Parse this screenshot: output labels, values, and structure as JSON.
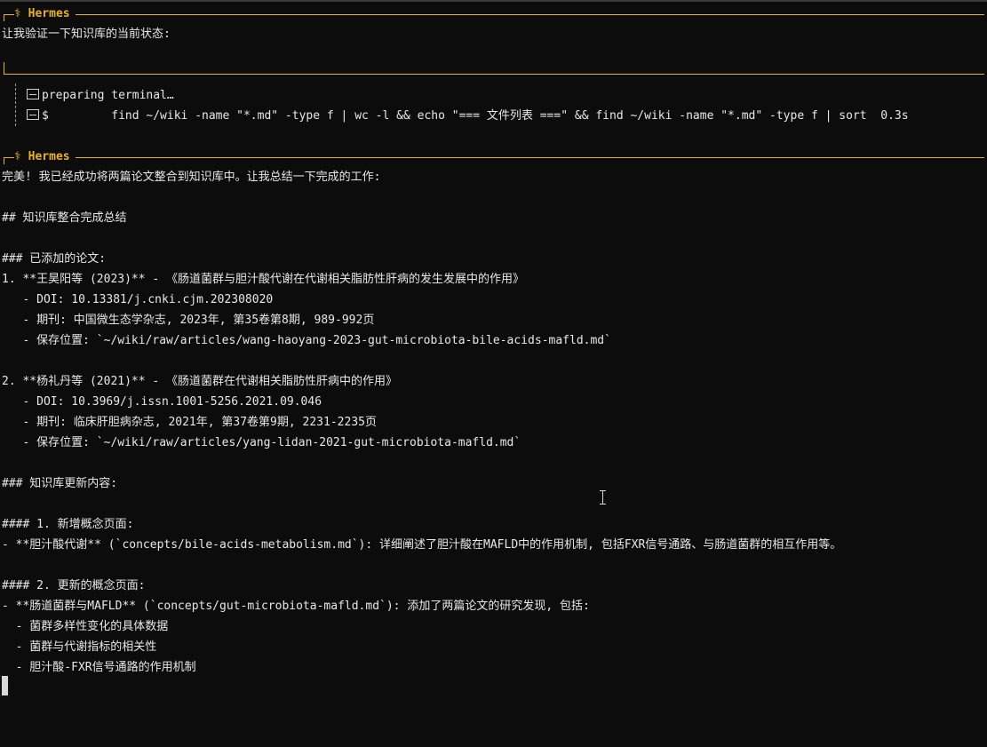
{
  "hermes_label": "⚕ Hermes",
  "block1": {
    "intro": "让我验证一下知识库的当前状态:"
  },
  "tool": {
    "line1": "preparing terminal…",
    "prompt": "$",
    "command": "         find ~/wiki -name \"*.md\" -type f | wc -l && echo \"=== 文件列表 ===\" && find ~/wiki -name \"*.md\" -type f | sort  0.3s"
  },
  "block2": {
    "lines": [
      "完美! 我已经成功将两篇论文整合到知识库中。让我总结一下完成的工作:",
      "",
      "## 知识库整合完成总结",
      "",
      "### 已添加的论文:",
      "1. **王昊阳等 (2023)** - 《肠道菌群与胆汁酸代谢在代谢相关脂肪性肝病的发生发展中的作用》",
      "   - DOI: 10.13381/j.cnki.cjm.202308020",
      "   - 期刊: 中国微生态学杂志, 2023年, 第35卷第8期, 989-992页",
      "   - 保存位置: `~/wiki/raw/articles/wang-haoyang-2023-gut-microbiota-bile-acids-mafld.md`",
      "",
      "2. **杨礼丹等 (2021)** - 《肠道菌群在代谢相关脂肪性肝病中的作用》",
      "   - DOI: 10.3969/j.issn.1001-5256.2021.09.046",
      "   - 期刊: 临床肝胆病杂志, 2021年, 第37卷第9期, 2231-2235页",
      "   - 保存位置: `~/wiki/raw/articles/yang-lidan-2021-gut-microbiota-mafld.md`",
      "",
      "### 知识库更新内容:",
      "",
      "#### 1. 新增概念页面:",
      "- **胆汁酸代谢** (`concepts/bile-acids-metabolism.md`): 详细阐述了胆汁酸在MAFLD中的作用机制, 包括FXR信号通路、与肠道菌群的相互作用等。",
      "",
      "#### 2. 更新的概念页面:",
      "- **肠道菌群与MAFLD** (`concepts/gut-microbiota-mafld.md`): 添加了两篇论文的研究发现, 包括:",
      "  - 菌群多样性变化的具体数据",
      "  - 菌群与代谢指标的相关性",
      "  - 胆汁酸-FXR信号通路的作用机制"
    ]
  }
}
